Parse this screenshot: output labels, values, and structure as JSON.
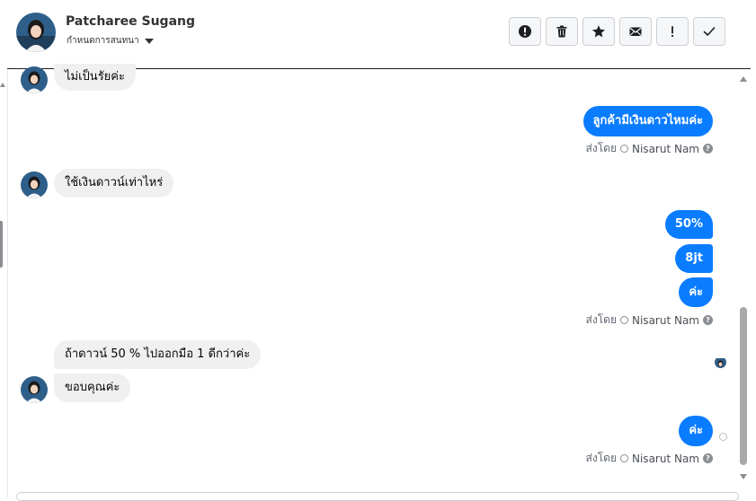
{
  "contact": {
    "name": "Patcharee Sugang",
    "stage_label": "กำหนดการสนทนา"
  },
  "toolbar": [
    {
      "icon": "alert-circle-icon",
      "name": "mark-spam-button"
    },
    {
      "icon": "trash-icon",
      "name": "delete-button"
    },
    {
      "icon": "star-icon",
      "name": "star-button"
    },
    {
      "icon": "envelope-icon",
      "name": "mark-unread-button"
    },
    {
      "icon": "exclamation-icon",
      "name": "follow-up-button"
    },
    {
      "icon": "check-icon",
      "name": "mark-done-button"
    }
  ],
  "messages": {
    "in_1": "ไม่เป็นรัยค่ะ",
    "out_1": "ลูกค้ามีเงินดาวไหมค่ะ",
    "in_2": "ใช้เงินดาวน์เท่าไหร่",
    "out_2a": "50%",
    "out_2b": "8jt",
    "out_2c": "ค่ะ",
    "in_3a": "ถ้าดาวน์ 50 % ไปออกมือ 1 ดีกว่าค่ะ",
    "in_3b": "ขอบคุณค่ะ",
    "out_3": "ค่ะ"
  },
  "sent_by": {
    "prefix": "ส่งโดย",
    "agent": "Nisarut Nam",
    "help": "?"
  },
  "colors": {
    "outgoing_bubble": "#0a7cff",
    "incoming_bubble": "#f0f0f0"
  }
}
